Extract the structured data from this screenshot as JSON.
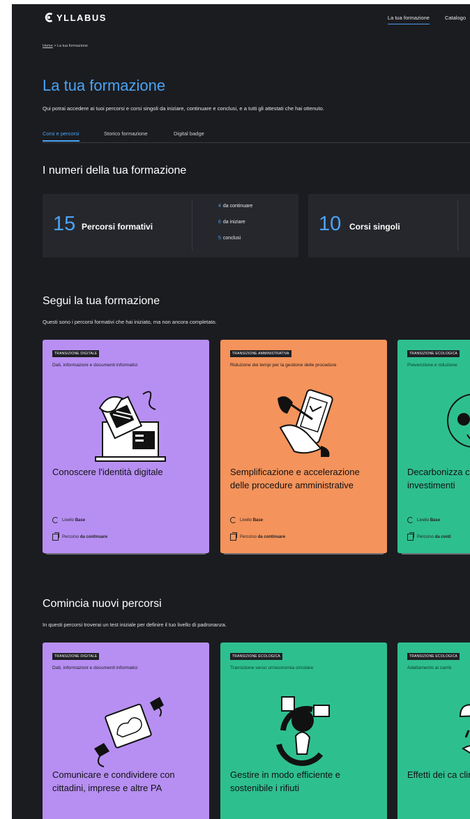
{
  "header": {
    "logo_text": "YLLABUS",
    "nav": [
      "La tua formazione",
      "Catalogo"
    ]
  },
  "breadcrumb": {
    "home": "Home",
    "separator": " > ",
    "current": "La tua formazione"
  },
  "page": {
    "title": "La tua formazione",
    "description": "Qui potrai accedere ai tuoi percorsi e corsi singoli da iniziare, continuare e conclusi, e a tutti gli attestati che hai ottenuto."
  },
  "tabs": [
    "Corsi e percorsi",
    "Storico formazione",
    "Digital badge"
  ],
  "stats": {
    "title": "I numeri della tua formazione",
    "percorsi": {
      "number": "15",
      "label": "Percorsi formativi",
      "breakdown": [
        {
          "count": "4",
          "label": "da continuare"
        },
        {
          "count": "6",
          "label": "da iniziare"
        },
        {
          "count": "5",
          "label": "conclusi"
        }
      ]
    },
    "corsi": {
      "number": "10",
      "label": "Corsi singoli"
    }
  },
  "continue_section": {
    "title": "Segui la tua formazione",
    "subtitle": "Questi sono i percorsi formativi che hai iniziato, ma non ancora completato.",
    "cards": [
      {
        "badge": "TRANSIZIONE DIGITALE",
        "category": "Dati, informazioni e documenti informatici",
        "title": "Conoscere l'identità digitale",
        "level_prefix": "Livello ",
        "level": "Base",
        "status_prefix": "Percorso ",
        "status": "da continuare"
      },
      {
        "badge": "TRANSIZIONE AMMINISTRATIVA",
        "category": "Riduzione dei tempi per la gestione delle procedure",
        "title": "Semplificazione e accelerazione delle procedure amministrative",
        "level_prefix": "Livello ",
        "level": "Base",
        "status_prefix": "Percorso ",
        "status": "da continuare"
      },
      {
        "badge": "TRANSIZIONE ECOLOGICA",
        "category": "Prevenzione e riduzione",
        "title": "Decarbonizza cinque linee investimenti",
        "level_prefix": "Livello ",
        "level": "Base",
        "status_prefix": "Percorso ",
        "status": "da conti"
      }
    ]
  },
  "new_section": {
    "title": "Comincia nuovi percorsi",
    "subtitle": "In questi percorsi troverai un test iniziale per definire il tuo livello di padronanza.",
    "cards": [
      {
        "badge": "TRANSIZIONE DIGITALE",
        "category": "Dati, informazioni e documenti informatici",
        "title": "Comunicare e condividere con cittadini, imprese e altre PA"
      },
      {
        "badge": "TRANSIZIONE ECOLOGICA",
        "category": "Transizione verso un'economia circolare",
        "title": "Gestire in modo efficiente e sostenibile i rifiuti"
      },
      {
        "badge": "TRANSIZIONE ECOLOGICA",
        "category": "Adattamento ai camb",
        "title": "Effetti dei ca climatici"
      }
    ]
  },
  "colors": {
    "background": "#1b1c20",
    "accent": "#4aa3f5",
    "card_purple": "#b78ff2",
    "card_orange": "#f4935b",
    "card_green": "#2ebf8f"
  }
}
